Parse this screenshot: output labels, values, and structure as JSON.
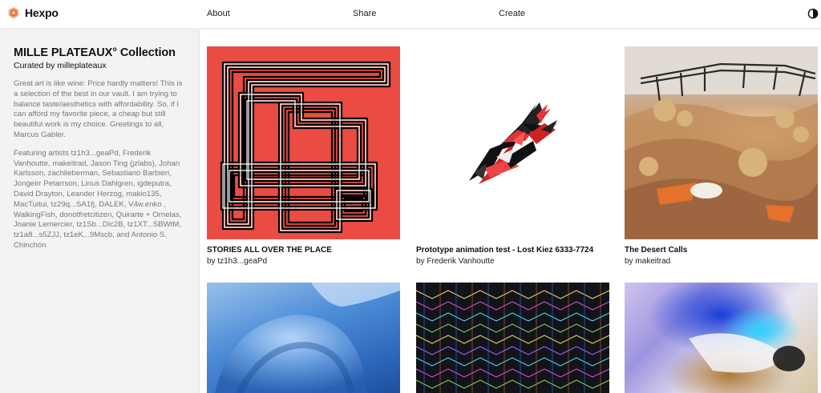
{
  "header": {
    "brand": "Hexpo",
    "nav": {
      "about": "About",
      "share": "Share",
      "create": "Create"
    }
  },
  "sidebar": {
    "title": "MILLE PLATEAUX° Collection",
    "curator": "Curated by milleplateaux",
    "description": "Great art is like wine: Price hardly matters! This is a selection of the best in our vault. I am trying to balance taste/aesthetics with affordability. So, if I can afford my favorite piece, a cheap but still beautiful work is my choice. Greetings to all, Marcus Gabler.",
    "artists": "Featuring artists tz1h3...geaPd, Frederik Vanhoutte, makeitrad, Jason Ting (jzlabs), Johan Karlsson, zachlieberman, Sebastiano Barbieri, Jongeirr Petarrson, Linus Dahlgren, igdeputra, David Drayton, Leander Herzog, makio135, MacTuitui, tz29q...SA1fj, DALEK, V4w.enko , WalkingFish, donotfretcitizen, Quirarte + Ornelas, Joanie Lemercier, tz1Sb...Dic2B, tz1XT...SBWtM, tz1a8...s5ZJJ, tz1eK...9Mscb, and Antonio S. Chinchón"
  },
  "cards": [
    {
      "title": "STORIES ALL OVER THE PLACE",
      "artist": "by tz1h3...geaPd"
    },
    {
      "title": "Prototype animation test - Lost Kiez 6333-7724",
      "artist": "by Frederik Vanhoutte"
    },
    {
      "title": "The Desert Calls",
      "artist": "by makeitrad"
    },
    {
      "title": "",
      "artist": ""
    },
    {
      "title": "",
      "artist": ""
    },
    {
      "title": "",
      "artist": ""
    }
  ],
  "colors": {
    "accent_logo": "#e8703a",
    "card1_bg": "#ea4c43",
    "sidebar_bg": "#f3f3f3"
  },
  "icons": {
    "logo": "hexagon-logo-icon",
    "theme": "half-circle-theme-icon"
  }
}
